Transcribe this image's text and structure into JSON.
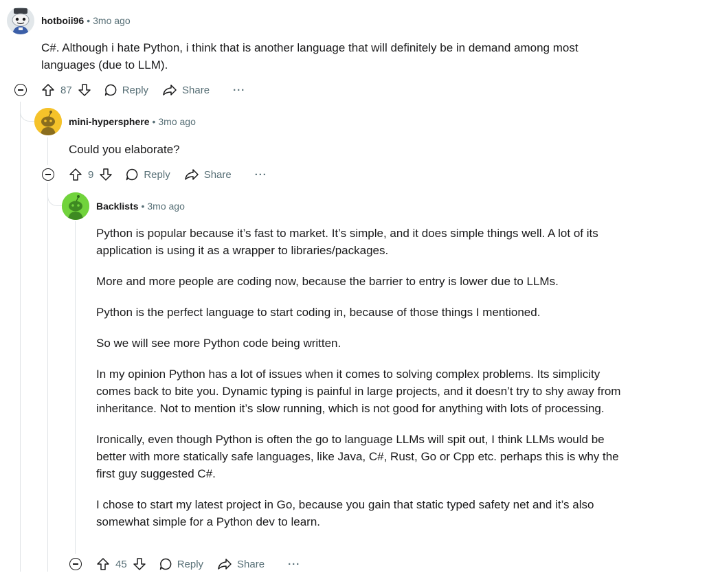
{
  "colors": {
    "text": "#1a1a1b",
    "meta": "#576f76",
    "thread_line": "#dfe3e6"
  },
  "comments": [
    {
      "username": "hotboii96",
      "separator": "•",
      "time": "3mo ago",
      "avatar": "reddit-snoo-astronaut-avatar",
      "paragraphs": [
        "C#. Although i hate Python, i think that is another language that will definitely be in demand among most languages (due to LLM)."
      ],
      "score": "87",
      "reply_label": "Reply",
      "share_label": "Share",
      "more_label": "···"
    },
    {
      "username": "mini-hypersphere",
      "separator": "•",
      "time": "3mo ago",
      "avatar": "reddit-snoo-yellow-avatar",
      "paragraphs": [
        "Could you elaborate?"
      ],
      "score": "9",
      "reply_label": "Reply",
      "share_label": "Share",
      "more_label": "···"
    },
    {
      "username": "Backlists",
      "separator": "•",
      "time": "3mo ago",
      "avatar": "reddit-snoo-green-avatar",
      "paragraphs": [
        "Python is popular because it’s fast to market. It’s simple, and it does simple things well. A lot of its application is using it as a wrapper to libraries/packages.",
        "More and more people are coding now, because the barrier to entry is lower due to LLMs.",
        "Python is the perfect language to start coding in, because of those things I mentioned.",
        "So we will see more Python code being written.",
        "In my opinion Python has a lot of issues when it comes to solving complex problems. Its simplicity comes back to bite you. Dynamic typing is painful in large projects, and it doesn’t try to shy away from inheritance. Not to mention it’s slow running, which is not good for anything with lots of processing.",
        "Ironically, even though Python is often the go to language LLMs will spit out, I think LLMs would be better with more statically safe languages, like Java, C#, Rust, Go or Cpp etc. perhaps this is why the first guy suggested C#.",
        "I chose to start my latest project in Go, because you gain that static typed safety net and it’s also somewhat simple for a Python dev to learn."
      ],
      "score": "45",
      "reply_label": "Reply",
      "share_label": "Share",
      "more_label": "···"
    }
  ]
}
